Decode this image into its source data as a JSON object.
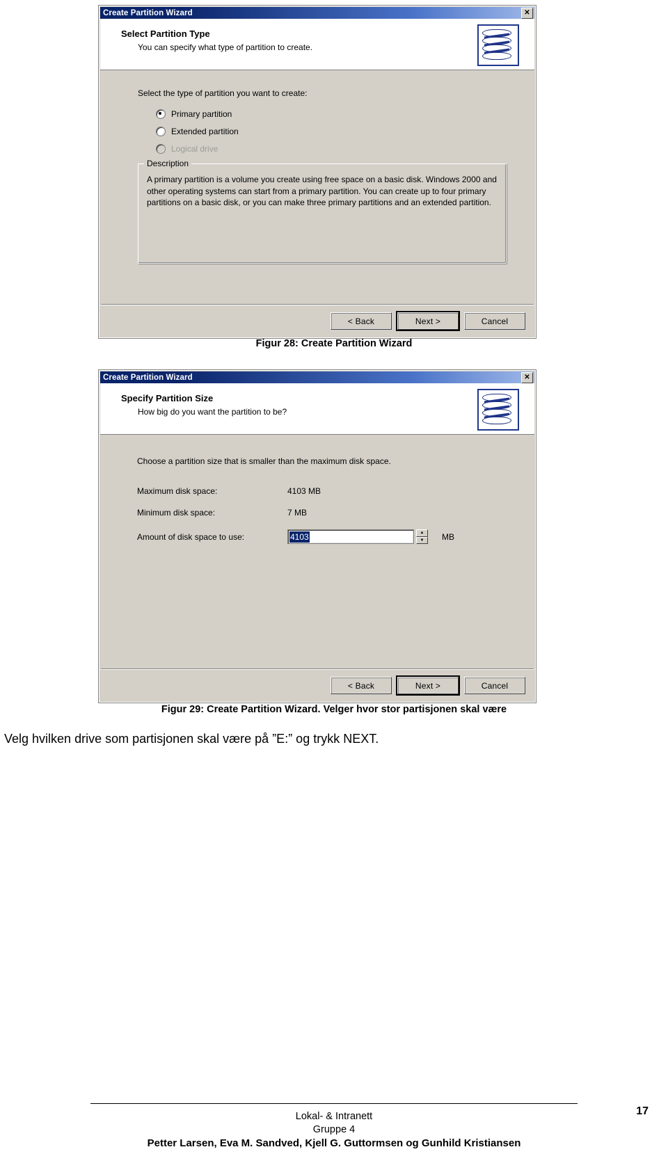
{
  "document": {
    "figure1_caption": "Figur 28: Create Partition Wizard",
    "figure2_caption": "Figur 29: Create Partition Wizard. Velger hvor stor partisjonen skal være",
    "body_text": "Velg hvilken drive som partisjonen skal være på ”E:” og trykk NEXT.",
    "page_number": "17",
    "footer": {
      "line1": "Lokal- & Intranett",
      "line2": "Gruppe 4",
      "line3": "Petter Larsen, Eva M. Sandved, Kjell G. Guttormsen og Gunhild Kristiansen"
    }
  },
  "dialog1": {
    "title": "Create Partition Wizard",
    "close_label": "✕",
    "header_title": "Select Partition Type",
    "header_subtitle": "You can specify what type of partition to create.",
    "prompt": "Select the type of partition you want to create:",
    "options": [
      {
        "label": "Primary partition",
        "checked": true,
        "disabled": false
      },
      {
        "label": "Extended partition",
        "checked": false,
        "disabled": false
      },
      {
        "label": "Logical drive",
        "checked": false,
        "disabled": true
      }
    ],
    "description_legend": "Description",
    "description_text": "A primary partition is a volume you create using free space on a basic disk. Windows 2000 and other operating systems can start from a primary partition. You can create up to four primary partitions on a basic disk, or you can make three primary partitions and an extended partition.",
    "buttons": {
      "back": "< Back",
      "next": "Next >",
      "cancel": "Cancel"
    }
  },
  "dialog2": {
    "title": "Create Partition Wizard",
    "close_label": "✕",
    "header_title": "Specify Partition Size",
    "header_subtitle": "How big do you want the partition to be?",
    "prompt": "Choose a partition size that is smaller than the maximum disk space.",
    "fields": [
      {
        "label": "Maximum disk space:",
        "value": "4103 MB"
      },
      {
        "label": "Minimum disk space:",
        "value": "7 MB"
      }
    ],
    "amount_label": "Amount of disk space to use:",
    "amount_value": "4103",
    "amount_unit": "MB",
    "spinner_up": "▲",
    "spinner_down": "▼",
    "buttons": {
      "back": "< Back",
      "next": "Next >",
      "cancel": "Cancel"
    }
  },
  "colors": {
    "titlebar_start": "#0a246a",
    "titlebar_end": "#9fb8e8",
    "dialog_face": "#d4d0c8",
    "selection": "#0a246a"
  }
}
